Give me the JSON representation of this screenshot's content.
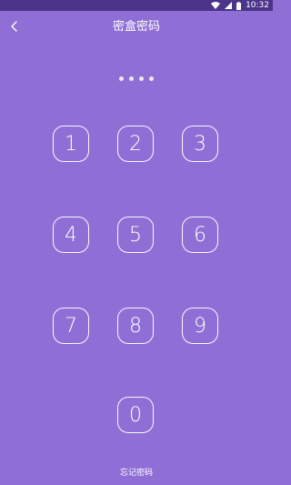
{
  "status_bar": {
    "time": "10:32"
  },
  "header": {
    "title": "密盒密码"
  },
  "pin": {
    "dot_count": 4
  },
  "keypad": {
    "keys": [
      "1",
      "2",
      "3",
      "4",
      "5",
      "6",
      "7",
      "8",
      "9",
      "0"
    ]
  },
  "footer": {
    "forgot_label": "忘记密码"
  },
  "colors": {
    "background": "#8F6FD6",
    "status_bar": "#4B3489",
    "foreground": "#FFFFFF"
  },
  "icons": {
    "back": "chevron-left-icon",
    "wifi": "wifi-icon",
    "signal": "signal-icon",
    "battery": "battery-icon"
  }
}
